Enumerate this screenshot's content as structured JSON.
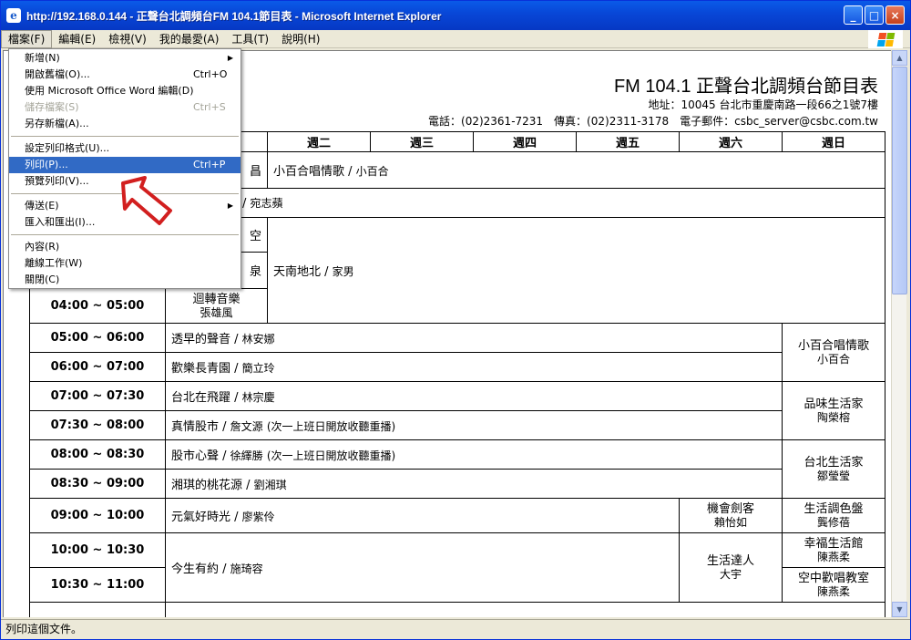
{
  "window": {
    "title": "http://192.168.0.144 - 正聲台北調頻台FM 104.1節目表 - Microsoft Internet Explorer",
    "icon": "e",
    "minimize_label": "_",
    "maximize_label": "□",
    "close_label": "×"
  },
  "menubar": {
    "items": [
      {
        "label": "檔案(F)"
      },
      {
        "label": "編輯(E)"
      },
      {
        "label": "檢視(V)"
      },
      {
        "label": "我的最愛(A)"
      },
      {
        "label": "工具(T)"
      },
      {
        "label": "說明(H)"
      }
    ]
  },
  "file_menu": {
    "items": [
      {
        "label": "新增(N)",
        "shortcut": "",
        "arrow": "▶"
      },
      {
        "label": "開啟舊檔(O)...",
        "shortcut": "Ctrl+O"
      },
      {
        "label": "使用 Microsoft Office Word 編輯(D)",
        "shortcut": ""
      },
      {
        "label": "儲存檔案(S)",
        "shortcut": "Ctrl+S"
      },
      {
        "label": "另存新檔(A)...",
        "shortcut": ""
      },
      {
        "label": "設定列印格式(U)...",
        "shortcut": ""
      },
      {
        "label": "列印(P)...",
        "shortcut": "Ctrl+P"
      },
      {
        "label": "預覽列印(V)...",
        "shortcut": ""
      },
      {
        "label": "傳送(E)",
        "shortcut": "",
        "arrow": "▶"
      },
      {
        "label": "匯入和匯出(I)...",
        "shortcut": ""
      },
      {
        "label": "內容(R)",
        "shortcut": ""
      },
      {
        "label": "離線工作(W)",
        "shortcut": ""
      },
      {
        "label": "關閉(C)",
        "shortcut": ""
      }
    ]
  },
  "page": {
    "title": "FM 104.1 正聲台北調頻台節目表",
    "address": "地址：10045 台北市重慶南路一段66之1號7樓",
    "contact": "電話：(02)2361-7231　傳真：(02)2311-3178　電子郵件：csbc_server@csbc.com.tw"
  },
  "schedule": {
    "headers": [
      "週二",
      "週三",
      "週四",
      "週五",
      "週六",
      "週日"
    ],
    "row1_partial": "昌",
    "prog_choir": {
      "name": "小百合唱情歌",
      "host": "小百合"
    },
    "row2_host_partial": "宛志蘋",
    "row3_partial": "空",
    "row4_partial": "泉",
    "prog_tiannan": {
      "name": "天南地北",
      "host": "家男"
    },
    "t0400": "04:00 ~ 05:00",
    "mon_0400": {
      "name": "迴轉音樂",
      "host": "張雄風"
    },
    "t0500": "05:00 ~ 06:00",
    "prog_0500": {
      "name": "透早的聲音",
      "host": "林安娜"
    },
    "t0600": "06:00 ~ 07:00",
    "prog_0600": {
      "name": "歡樂長青園",
      "host": "簡立玲"
    },
    "sun_0500": {
      "name": "小百合唱情歌",
      "host": "小百合"
    },
    "t0700": "07:00 ~ 07:30",
    "prog_0700": {
      "name": "台北在飛躍",
      "host": "林宗慶"
    },
    "t0730": "07:30 ~ 08:00",
    "prog_0730": {
      "name": "真情股市",
      "host": "詹文源",
      "note": "(次一上班日開放收聽重播)"
    },
    "sun_0700": {
      "name": "品味生活家",
      "host": "陶榮榕"
    },
    "t0800": "08:00 ~ 08:30",
    "prog_0800": {
      "name": "股市心聲",
      "host": "徐繹勝",
      "note": "(次一上班日開放收聽重播)"
    },
    "t0830": "08:30 ~ 09:00",
    "prog_0830": {
      "name": "湘琪的桃花源",
      "host": "劉湘琪"
    },
    "sun_0800": {
      "name": "台北生活家",
      "host": "鄒瑩瑩"
    },
    "t0900": "09:00 ~ 10:00",
    "prog_0900": {
      "name": "元氣好時光",
      "host": "廖紫伶"
    },
    "sat_0900": {
      "name": "機會劍客",
      "host": "賴怡如"
    },
    "sun_0900": {
      "name": "生活調色盤",
      "host": "龔修蓓"
    },
    "t1000": "10:00 ~ 10:30",
    "prog_1000": {
      "name": "今生有約",
      "host": "施琦容"
    },
    "sat_1000": {
      "name": "生活達人",
      "host": "大宇"
    },
    "sun_1000": {
      "name": "幸福生活館",
      "host": "陳燕柔"
    },
    "t1030": "10:30 ~ 11:00",
    "sun_1030": {
      "name": "空中歡唱教室",
      "host": "陳燕柔"
    }
  },
  "status": {
    "text": "列印這個文件。"
  },
  "colors": {
    "titlebar": "#0846d6",
    "menu_highlight": "#316ac5",
    "cursor_red": "#d21f1f",
    "flag_red": "#f25022",
    "flag_green": "#7fba00",
    "flag_blue": "#00a4ef",
    "flag_yellow": "#ffb900"
  }
}
